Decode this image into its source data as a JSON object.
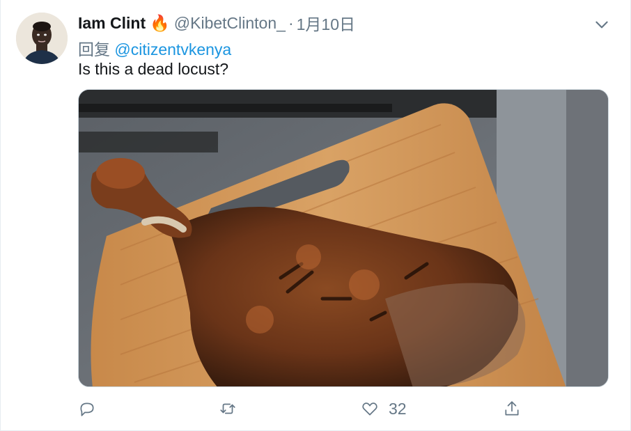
{
  "tweet": {
    "display_name": "Iam Clint",
    "name_emoji": "🔥",
    "handle": "@KibetClinton_",
    "separator": "·",
    "date": "1月10日",
    "reply_prefix": "回复",
    "reply_to": "@citizentvkenya",
    "text": "Is this a dead locust?"
  },
  "actions": {
    "reply_icon": "reply-icon",
    "retweet_icon": "retweet-icon",
    "like_icon": "heart-icon",
    "like_count": "32",
    "share_icon": "share-icon"
  },
  "colors": {
    "link": "#1b95e0",
    "secondary_text": "#657786",
    "primary_text": "#14171a"
  }
}
